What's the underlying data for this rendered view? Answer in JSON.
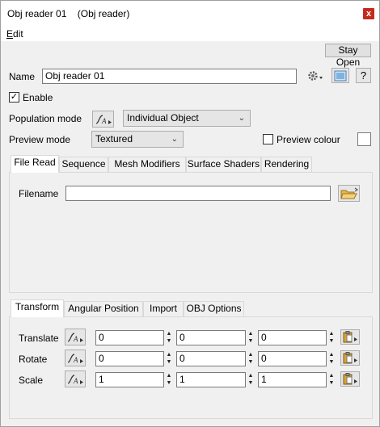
{
  "window": {
    "title": "Obj reader 01",
    "subtitle": "(Obj reader)",
    "close_glyph": "x"
  },
  "menu": {
    "edit_first": "E",
    "edit_rest": "dit"
  },
  "toolbar": {
    "stay_open": "Stay Open"
  },
  "name_row": {
    "label": "Name",
    "value": "Obj reader 01",
    "help": "?"
  },
  "enable": {
    "label": "Enable",
    "checked": true,
    "check_glyph": "✓"
  },
  "population": {
    "label": "Population mode",
    "value": "Individual Object"
  },
  "preview": {
    "label": "Preview mode",
    "value": "Textured",
    "colour_label": "Preview colour",
    "colour_checked": false,
    "colour": "#ffffff"
  },
  "top_tabs": [
    "File Read",
    "Sequence",
    "Mesh Modifiers",
    "Surface Shaders",
    "Rendering"
  ],
  "file_read": {
    "filename_label": "Filename",
    "filename_value": ""
  },
  "bottom_tabs": [
    "Transform",
    "Angular Position",
    "Import",
    "OBJ Options"
  ],
  "transform": {
    "rows": [
      {
        "label": "Translate",
        "values": [
          "0",
          "0",
          "0"
        ]
      },
      {
        "label": "Rotate",
        "values": [
          "0",
          "0",
          "0"
        ]
      },
      {
        "label": "Scale",
        "values": [
          "1",
          "1",
          "1"
        ]
      }
    ]
  },
  "icons": {
    "gear": "gear-icon",
    "view": "view-icon",
    "animate": "animate-curve-icon",
    "folder": "open-folder-icon",
    "paste": "clipboard-icon"
  }
}
